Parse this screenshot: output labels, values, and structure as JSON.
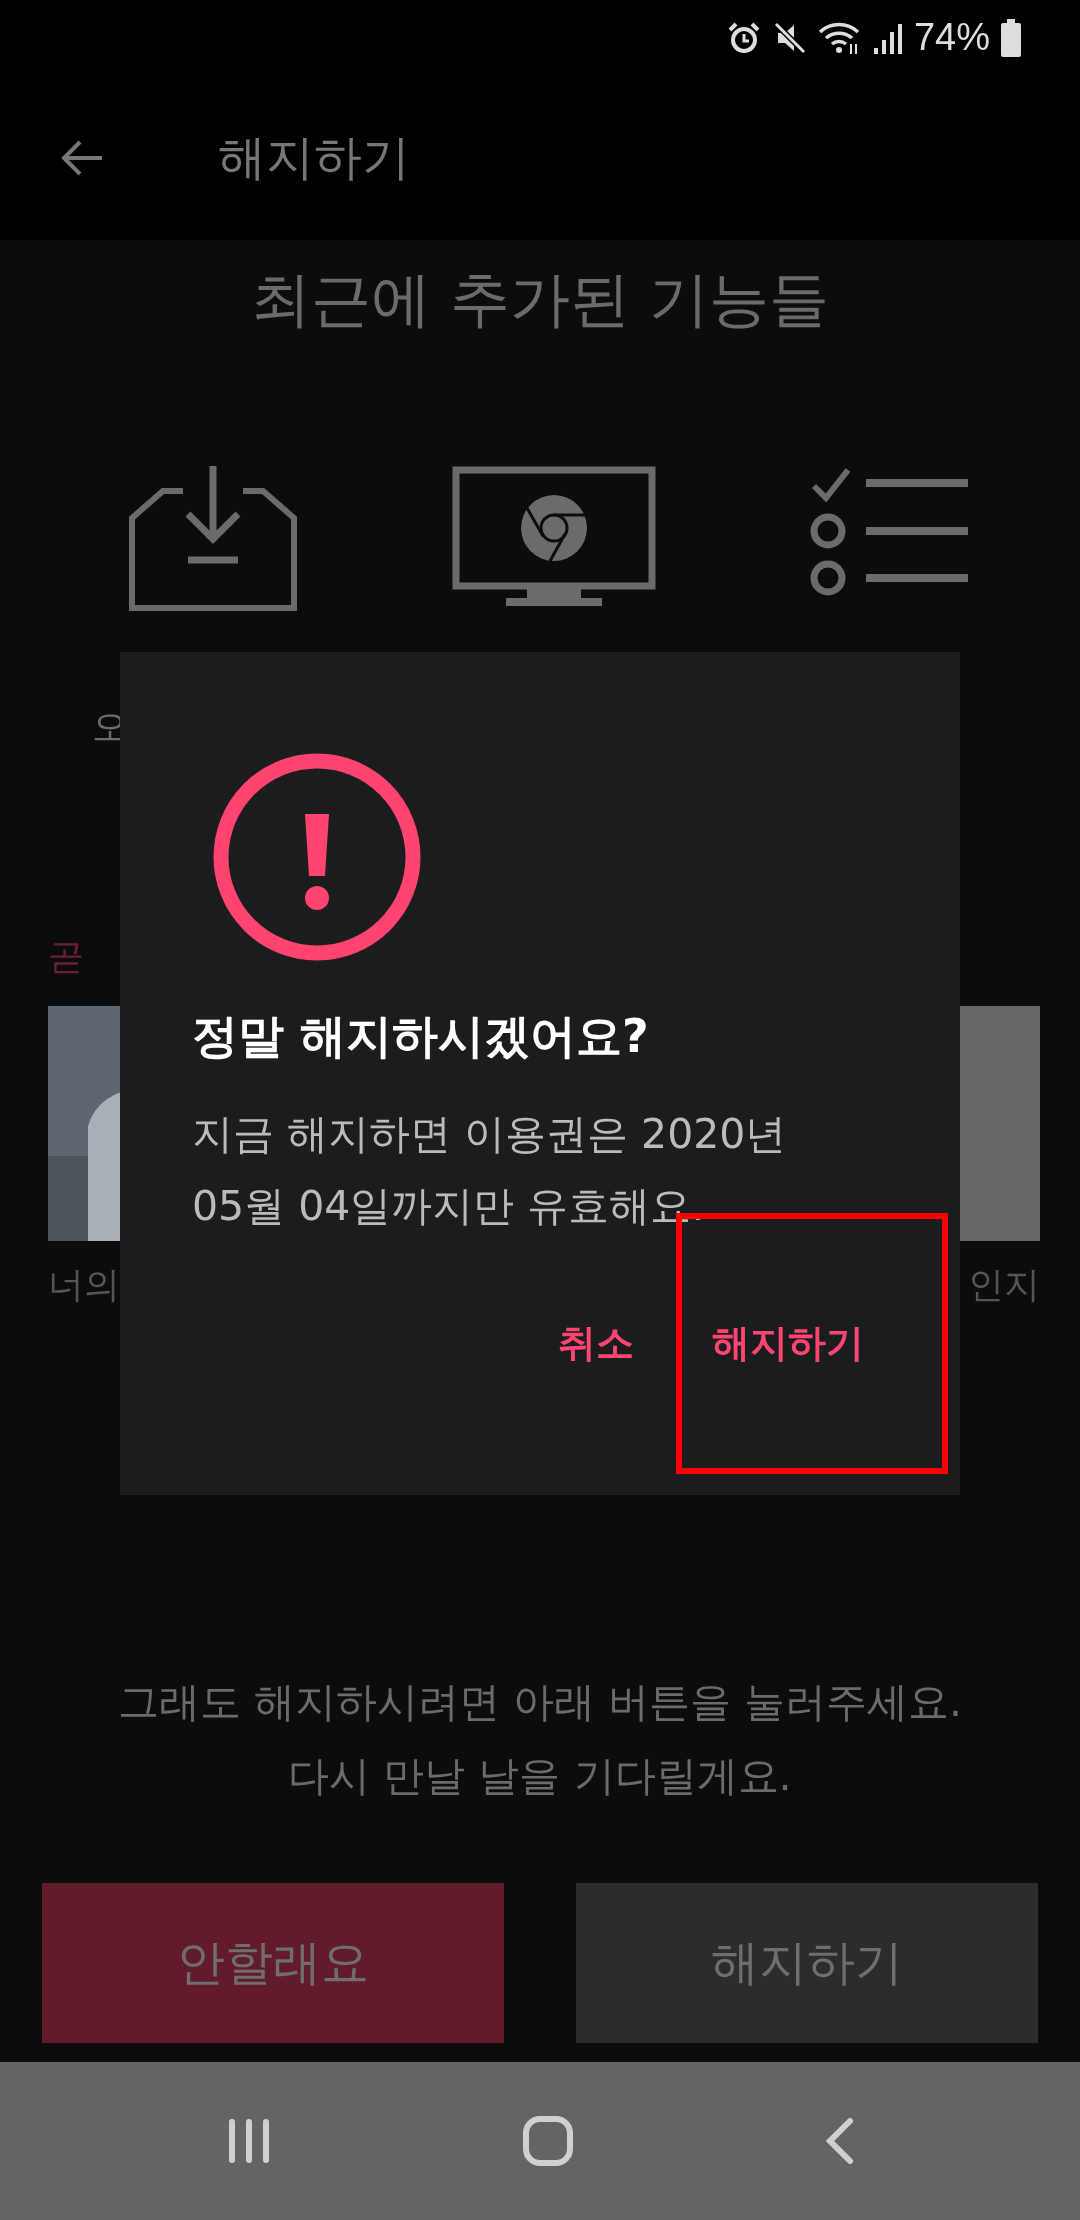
{
  "status_bar": {
    "battery": "74%"
  },
  "header": {
    "title": "해지하기"
  },
  "features": {
    "title": "최근에 추가된 기능들",
    "label": "오"
  },
  "upcoming": {
    "title": "곧",
    "posters": [
      {
        "kind": "picture",
        "caption": "너의"
      },
      {
        "kind": "blank",
        "caption": "인지"
      }
    ]
  },
  "dialog": {
    "title": "정말 해지하시겠어요?",
    "message_lines": [
      "지금 해지하면 이용권은 2020년",
      "05월 04일까지만 유효해요."
    ],
    "buttons": [
      {
        "label": "취소"
      },
      {
        "label": "해지하기",
        "highlighted": true
      }
    ]
  },
  "footer": {
    "message_lines": [
      "그래도 해지하시려면 아래 버튼을 눌러주세요.",
      "다시 만날 날을 기다릴게요."
    ],
    "buttons": [
      {
        "label": "안할래요",
        "kind": "primary"
      },
      {
        "label": "해지하기",
        "kind": "secondary"
      }
    ]
  }
}
